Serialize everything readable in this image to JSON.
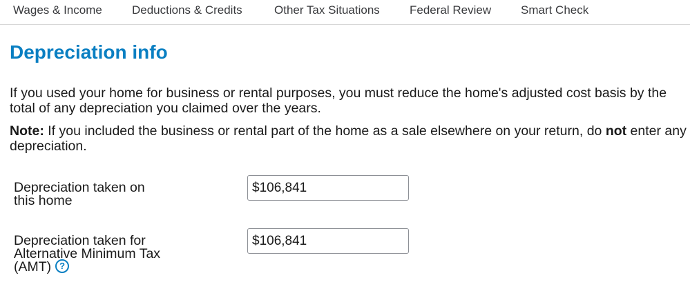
{
  "nav": {
    "items": [
      {
        "label": "Wages & Income"
      },
      {
        "label": "Deductions & Credits"
      },
      {
        "label": "Other Tax Situations"
      },
      {
        "label": "Federal Review"
      },
      {
        "label": "Smart Check"
      }
    ]
  },
  "page": {
    "title": "Depreciation info",
    "intro": "If you used your home for business or rental purposes, you must reduce the home's adjusted cost basis by the total of any depreciation you claimed over the years.",
    "note_label": "Note:",
    "note_text_before": " If you included the business or rental part of the home as a sale elsewhere on your return, do ",
    "note_emphasis": "not",
    "note_text_after": " enter any depreciation."
  },
  "form": {
    "depreciation_home": {
      "label": "Depreciation taken on this home",
      "value": "$106,841"
    },
    "depreciation_amt": {
      "label": "Depreciation taken for Alternative Minimum Tax (AMT)",
      "value": "$106,841",
      "help_icon": "question-circle-icon",
      "help_glyph": "?"
    }
  },
  "colors": {
    "accent": "#0a7fc2",
    "text": "#1a1a1a",
    "nav_text": "#393a3d"
  }
}
